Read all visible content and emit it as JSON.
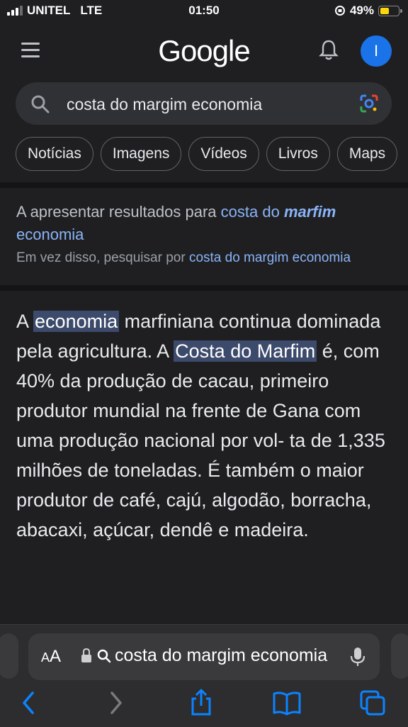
{
  "status": {
    "carrier": "UNITEL",
    "network": "LTE",
    "time": "01:50",
    "battery": "49%",
    "battery_level": 0.49
  },
  "header": {
    "logo": "Google",
    "avatar_initial": "I",
    "menu_icon": "hamburger-menu-icon",
    "bell_icon": "bell-icon"
  },
  "search": {
    "query": "costa do margim economia",
    "search_icon": "search-icon",
    "lens_icon": "google-lens-icon"
  },
  "chips": [
    "Notícias",
    "Imagens",
    "Vídeos",
    "Livros",
    "Maps"
  ],
  "spelling": {
    "showing_prefix": "A apresentar resultados para",
    "corrected_part1": "costa do",
    "corrected_bold": "marfim",
    "corrected_part2": "economia",
    "instead_prefix": "Em vez disso, pesquisar por",
    "original_query": "costa do margim economia"
  },
  "snippet": {
    "part1": "A ",
    "hl1": "economia",
    "part2": " marfiniana continua dominada pela agricultura. A ",
    "hl2": "Costa do Marfim",
    "part3": " é, com 40% da produção de cacau, primeiro produtor mundial na frente de Gana com uma produção nacional por vol- ta de 1,335 milhões de toneladas. É também o maior produtor de café, cajú, algodão, borracha, abacaxi, açúcar, dendê e madeira."
  },
  "browser": {
    "aa_label": "AA",
    "url_text": "costa do margim economia",
    "toolbar_icons": [
      "back-icon",
      "forward-icon",
      "share-icon",
      "bookmarks-icon",
      "tabs-icon"
    ]
  }
}
